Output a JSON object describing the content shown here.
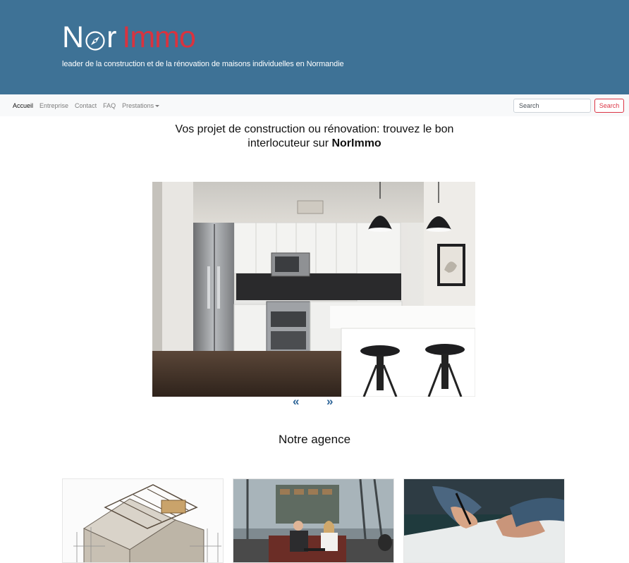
{
  "brand": {
    "part1": "N",
    "part2": "r",
    "part3": "Immo",
    "tagline": "leader de la construction et de la rénovation de maisons individuelles en Normandie",
    "logo_icon": "compass-icon",
    "colors": {
      "header_bg": "#3e7296",
      "accent": "#d9333f"
    }
  },
  "nav": {
    "items": [
      {
        "label": "Accueil",
        "active": true
      },
      {
        "label": "Entreprise"
      },
      {
        "label": "Contact"
      },
      {
        "label": "FAQ"
      },
      {
        "label": "Prestations"
      }
    ],
    "search": {
      "placeholder": "Search",
      "button_label": "Search"
    }
  },
  "headline": {
    "line1": "Vos projet de construction ou rénovation: trouvez le bon",
    "line2": "interlocuteur sur ",
    "brand": "NorImmo"
  },
  "carousel": {
    "prev": "«",
    "next": "»",
    "image_alt": "Cuisine moderne"
  },
  "agency": {
    "title": "Notre agence",
    "cards": [
      {
        "image": "house-construction-image"
      },
      {
        "image": "office-meeting-image"
      },
      {
        "image": "signing-document-image"
      }
    ]
  }
}
